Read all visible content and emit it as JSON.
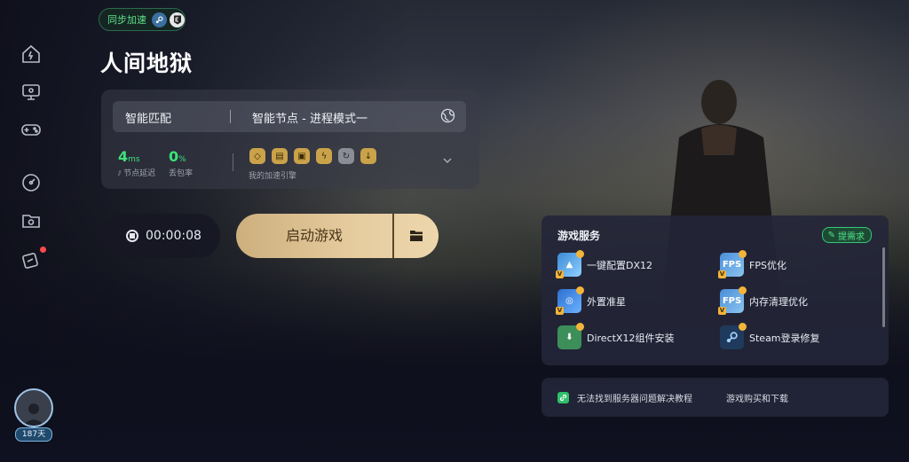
{
  "sync": {
    "label": "同步加速"
  },
  "game": {
    "title": "人间地狱"
  },
  "connection": {
    "mode": "智能匹配",
    "node": "智能节点 - 进程模式一",
    "latency_value": "4",
    "latency_unit": "ms",
    "latency_label": "节点延迟",
    "loss_value": "0",
    "loss_unit": "%",
    "loss_label": "丢包率",
    "engine_label": "我的加速引擎"
  },
  "timer": {
    "elapsed": "00:00:08"
  },
  "actions": {
    "start_label": "启动游戏"
  },
  "services": {
    "title": "游戏服务",
    "request_label": "提需求",
    "items": [
      {
        "label": "一键配置DX12",
        "icon": "dx12-config-icon"
      },
      {
        "label": "FPS优化",
        "icon": "fps-icon"
      },
      {
        "label": "外置准星",
        "icon": "crosshair-icon"
      },
      {
        "label": "内存清理优化",
        "icon": "fps-icon"
      },
      {
        "label": "DirectX12组件安装",
        "icon": "directx-install-icon"
      },
      {
        "label": "Steam登录修复",
        "icon": "steam-icon"
      }
    ]
  },
  "links": {
    "server_help": "无法找到服务器问题解决教程",
    "buy_download": "游戏购买和下载"
  },
  "user": {
    "days": "187天"
  },
  "colors": {
    "accent_green": "#3ce37a",
    "start_gold": "#e6cda0",
    "panel": "#24263a"
  }
}
